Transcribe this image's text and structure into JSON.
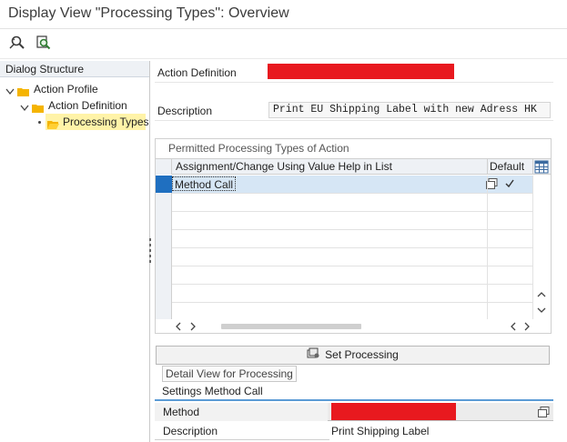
{
  "window": {
    "title": "Display View \"Processing Types\": Overview"
  },
  "toolbar": {
    "icons": [
      "display-object-icon",
      "find-icon"
    ]
  },
  "dialog_structure": {
    "header": "Dialog Structure",
    "items": [
      {
        "label": "Action Profile",
        "level": 0,
        "expanded": true
      },
      {
        "label": "Action Definition",
        "level": 1,
        "expanded": true
      },
      {
        "label": "Processing Types",
        "level": 2,
        "selected": true
      }
    ]
  },
  "header_fields": {
    "action_definition_label": "Action Definition",
    "description_label": "Description",
    "description_value": "Print EU Shipping Label with new Adress HK"
  },
  "processing_table": {
    "title": "Permitted Processing Types of Action",
    "columns": [
      "Assignment/Change Using Value Help in List",
      "Default"
    ],
    "rows": [
      {
        "assignment": "Method Call",
        "default": true
      }
    ]
  },
  "set_processing_button": {
    "label": "Set Processing"
  },
  "detail": {
    "tab_label": "Detail View for Processing",
    "section_title": "Settings Method Call",
    "method_label": "Method",
    "description_label": "Description",
    "description_value": "Print Shipping Label"
  },
  "colors": {
    "header_bg": "#eef1f5",
    "selected_row": "#d6e6f5",
    "selection_highlight": "#fff3a8",
    "folder": "#f5b400",
    "redaction": "#e8191f",
    "accent_line": "#5b9bd5"
  }
}
